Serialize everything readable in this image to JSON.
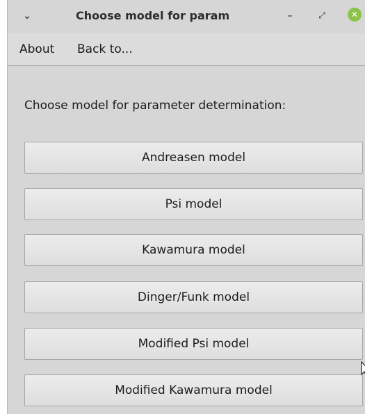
{
  "window": {
    "title": "Choose model for param",
    "close_glyph": "✕",
    "collapse_glyph": "⌄",
    "minimize_glyph": "–",
    "maximize_glyph": "⤢"
  },
  "menubar": {
    "items": [
      "About",
      "Back to..."
    ]
  },
  "main": {
    "prompt": "Choose model for parameter determination:",
    "buttons": [
      "Andreasen model",
      "Psi model",
      "Kawamura model",
      "Dinger/Funk model",
      "Modified Psi model",
      "Modified Kawamura model"
    ]
  },
  "colors": {
    "window_bg": "#d6d6d6",
    "close_button": "#8bc34a"
  }
}
